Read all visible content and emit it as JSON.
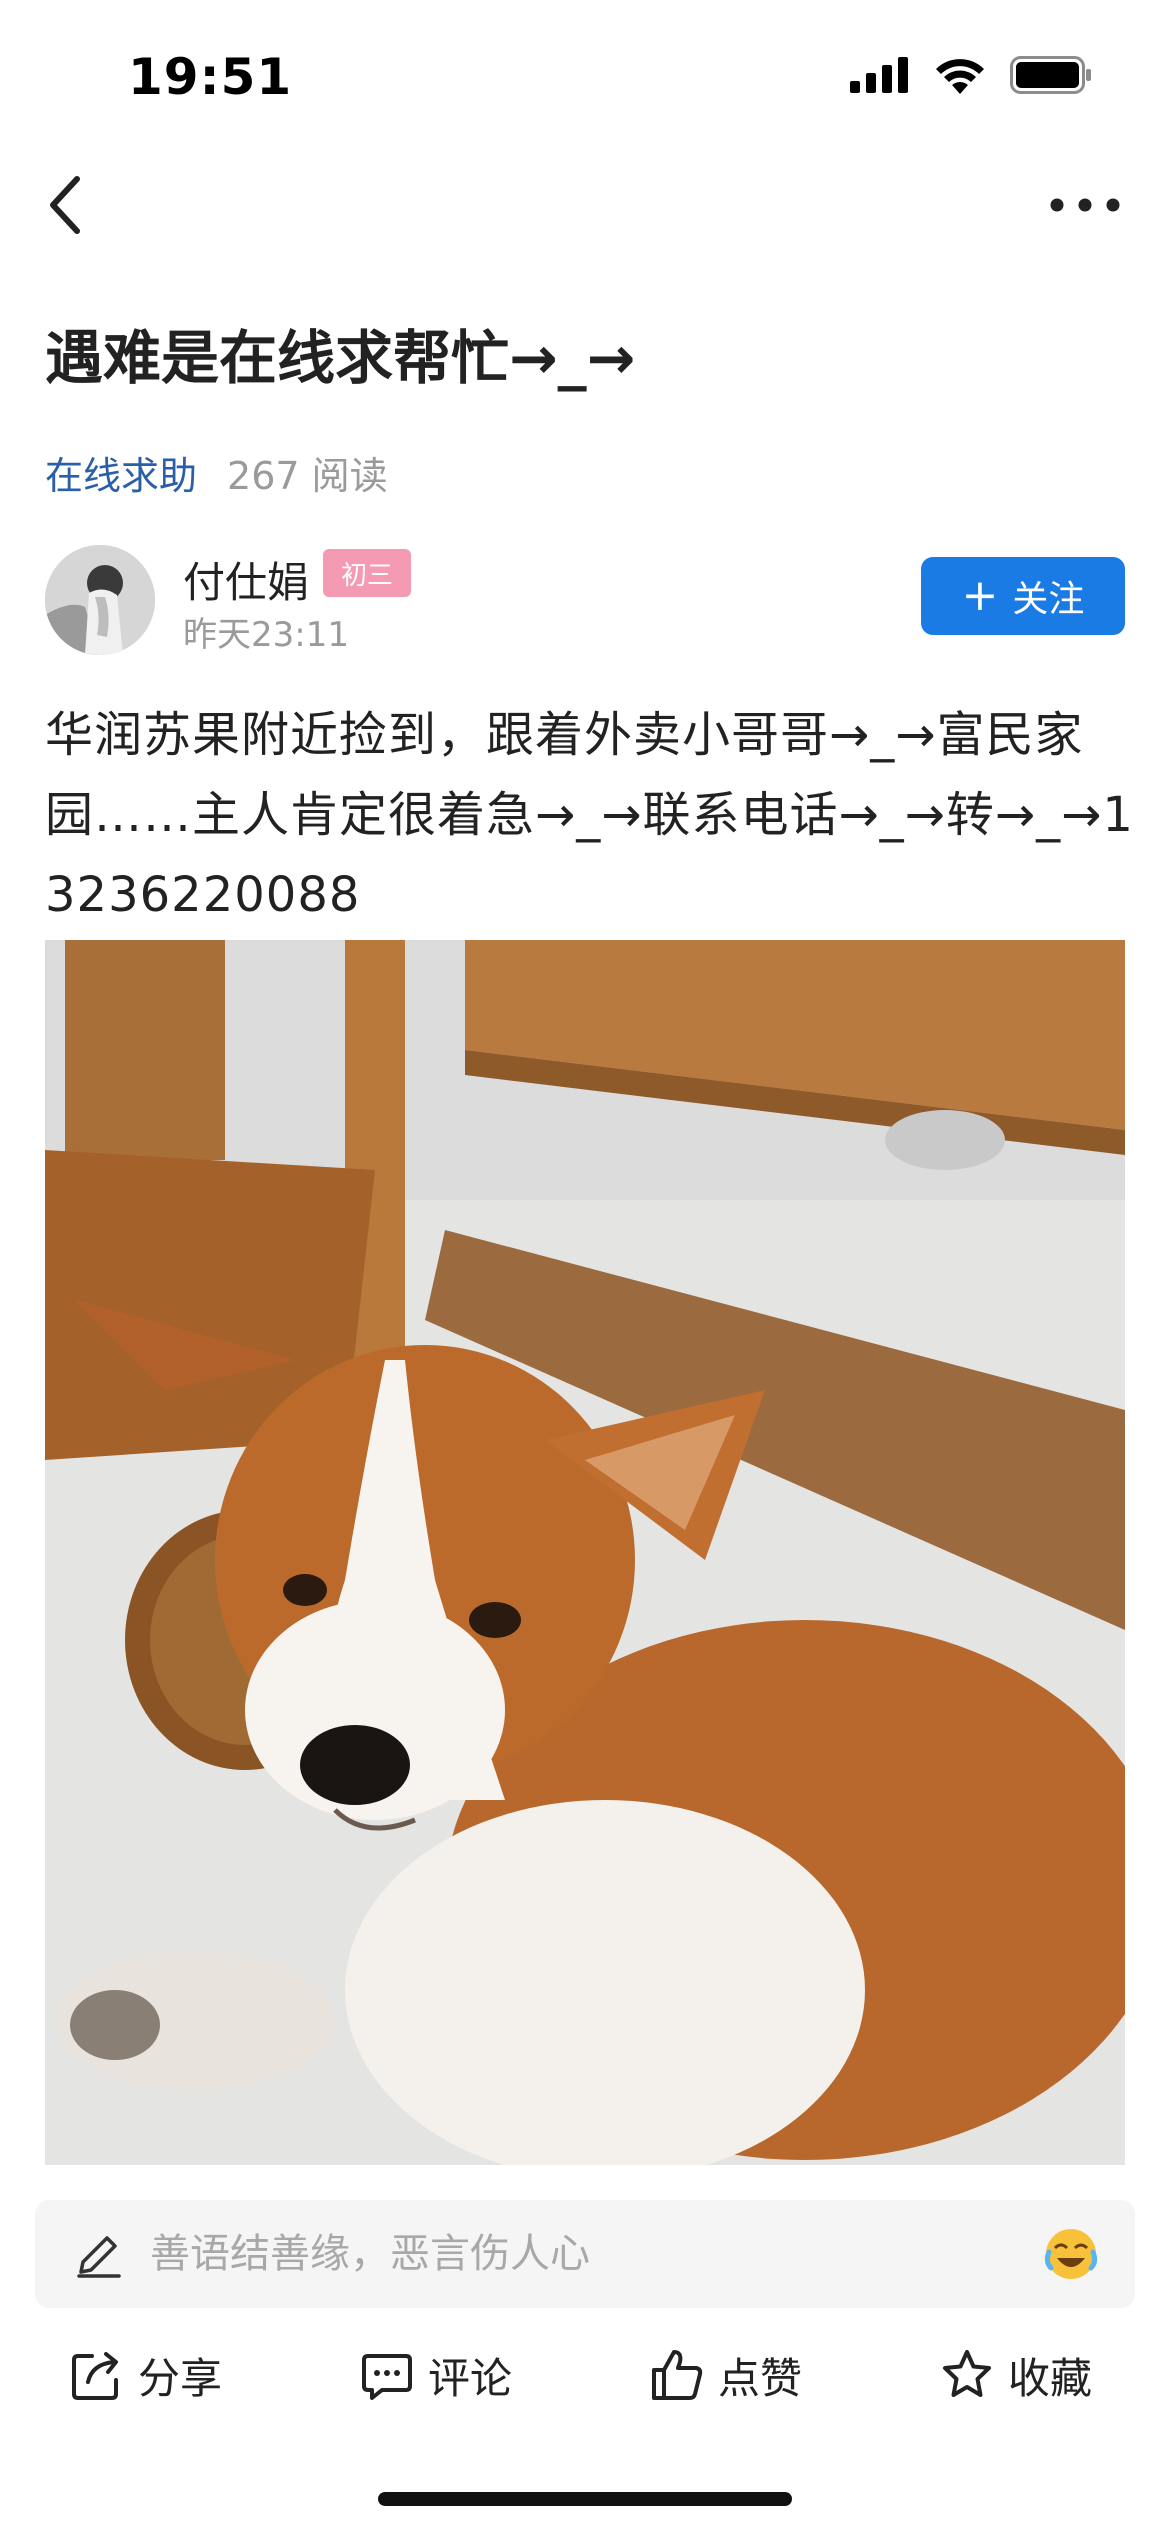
{
  "status_bar": {
    "time": "19:51",
    "icons": [
      "signal-icon",
      "wifi-icon",
      "battery-icon"
    ]
  },
  "nav": {
    "back_icon": "chevron-left-icon",
    "more_icon": "more-horizontal-icon"
  },
  "post": {
    "title": "遇难是在线求帮忙→_→",
    "category": "在线求助",
    "read_count": "267 阅读",
    "body": "华润苏果附近捡到，跟着外卖小哥哥→_→富民家园……主人肯定很着急→_→联系电话→_→转→_→13236220088"
  },
  "author": {
    "name": "付仕娟",
    "badge": "初三",
    "time": "昨天23:11",
    "follow_label": "关注"
  },
  "comment": {
    "placeholder": "善语结善缘，恶言伤人心"
  },
  "actions": {
    "share": "分享",
    "comment": "评论",
    "like": "点赞",
    "favorite": "收藏"
  },
  "colors": {
    "accent": "#1a7be5",
    "category_link": "#2a5fa8",
    "badge": "#f59ab3",
    "muted_text": "#9a9a9a"
  }
}
